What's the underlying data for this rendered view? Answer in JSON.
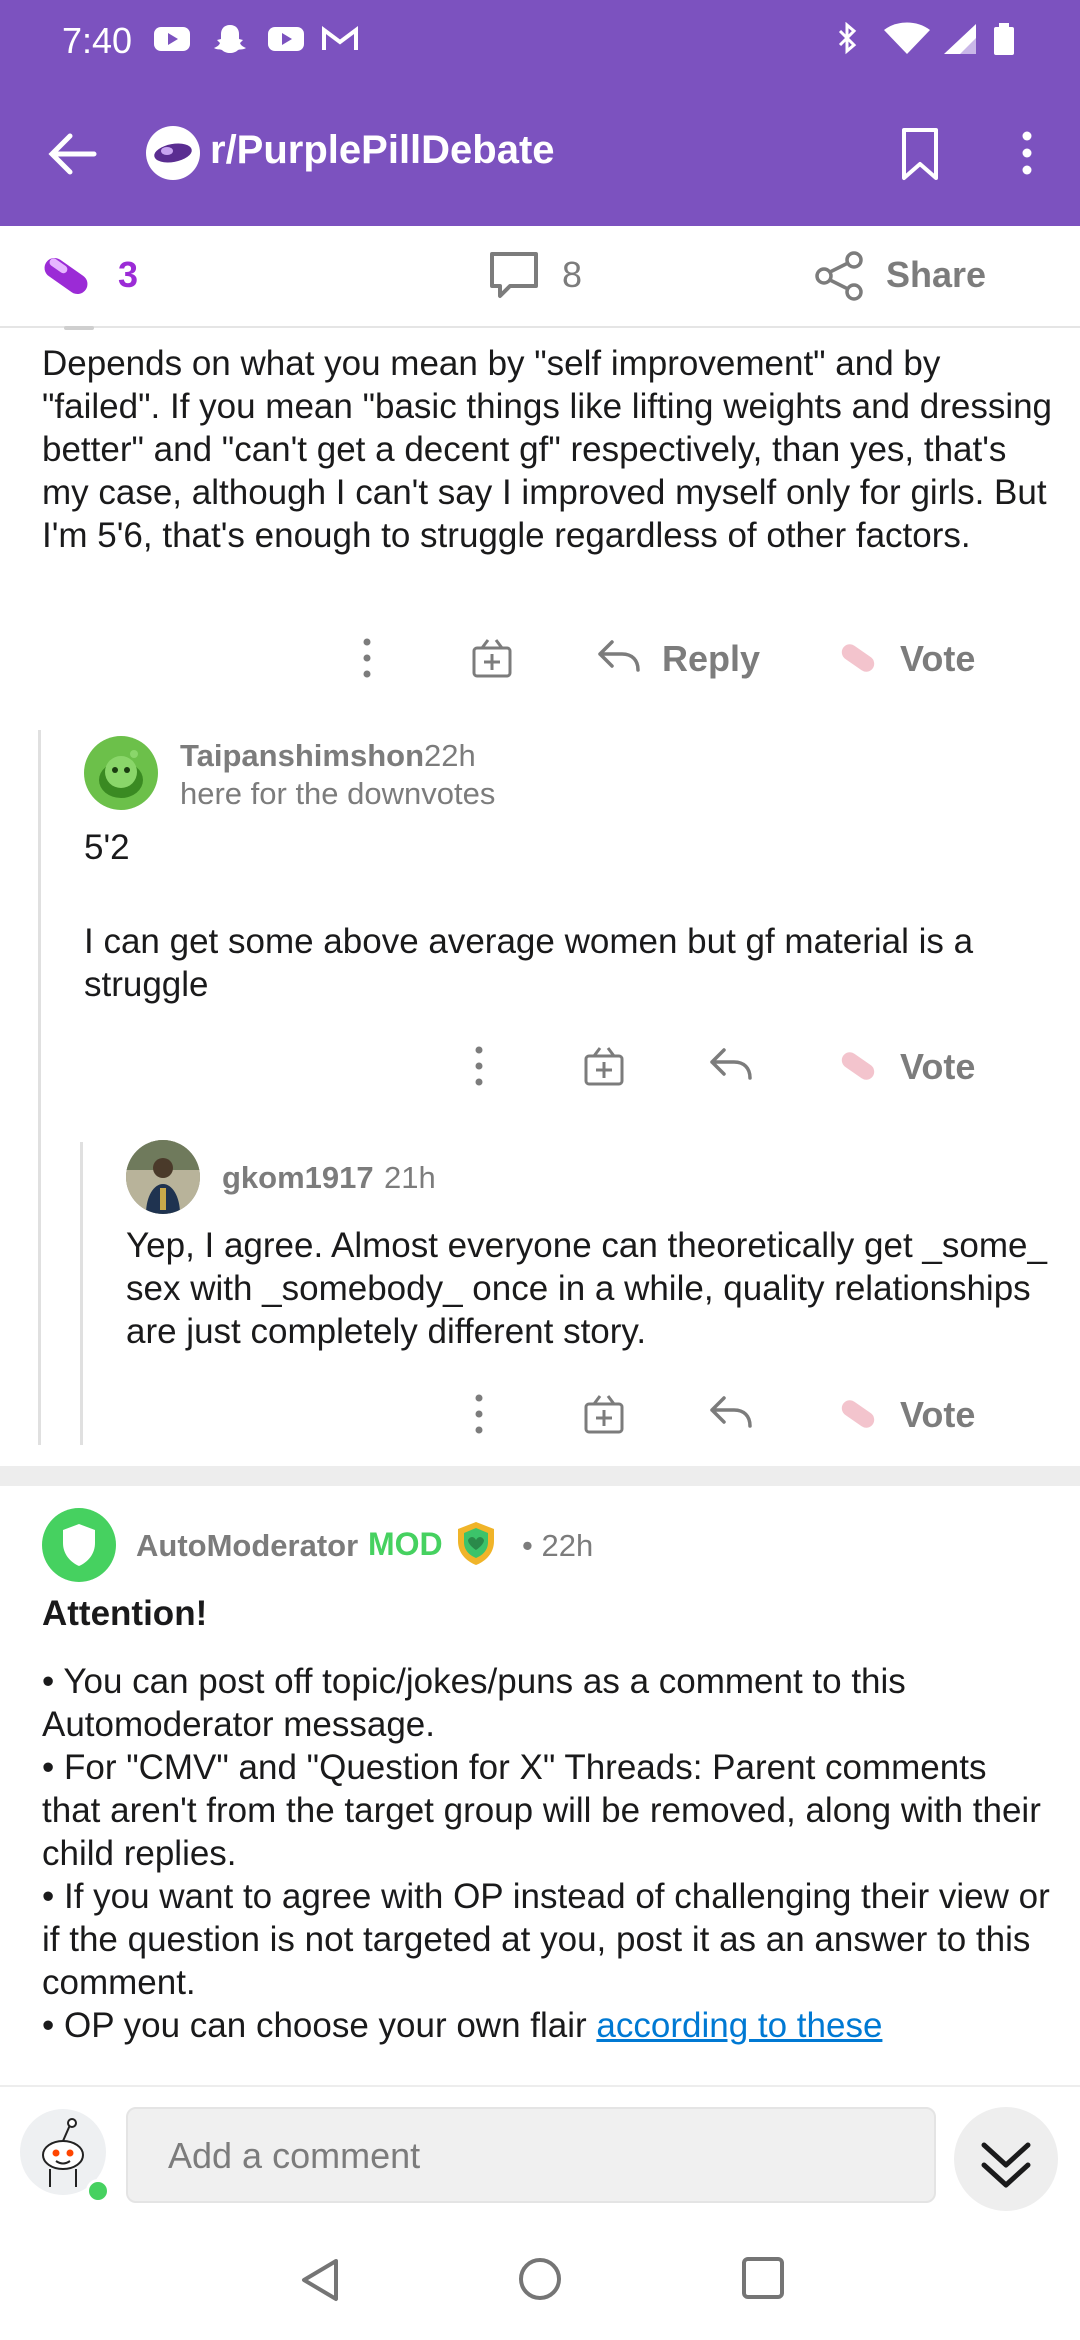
{
  "status": {
    "time": "7:40"
  },
  "header": {
    "subreddit": "r/PurplePillDebate"
  },
  "post_actions": {
    "votes": "3",
    "comments": "8",
    "share": "Share"
  },
  "comment1": {
    "text": "Depends on what you mean by \"self improvement\" and by \"failed\". If you mean \"basic things like lifting weights and dressing better\" and \"can't get a decent gf\" respectively, than yes, that's my case, although I can't say I improved myself only for girls. But I'm 5'6, that's enough to struggle regardless of other factors.",
    "reply": "Reply",
    "vote": "Vote"
  },
  "comment2": {
    "username": "Taipanshimshon",
    "time": "22h",
    "flair": "here for the downvotes",
    "line1": "5'2",
    "line2": "I can get some above average women but gf material is a struggle",
    "vote": "Vote"
  },
  "comment3": {
    "username": "gkom1917",
    "time": "21h",
    "text": "Yep, I agree. Almost everyone can theoretically get _some_ sex with _somebody_ once in a while, quality relationships are just completely different story.",
    "vote": "Vote"
  },
  "automod": {
    "username": "AutoModerator",
    "mod": "MOD",
    "time": "• 22h",
    "title": "Attention!",
    "bullet1": "• You can post off topic/jokes/puns as a comment to this Automoderator message.",
    "bullet2": "• For \"CMV\" and \"Question for X\" Threads: Parent comments that aren't from the target group will be removed, along with their child replies.",
    "bullet3": "• If you want to agree with OP instead of challenging their view or if the question is not targeted at you, post it as an answer to this comment.",
    "bullet4_prefix": "• OP you can choose your own flair ",
    "bullet4_link": "according to these"
  },
  "comment_input": {
    "placeholder": "Add a comment"
  }
}
